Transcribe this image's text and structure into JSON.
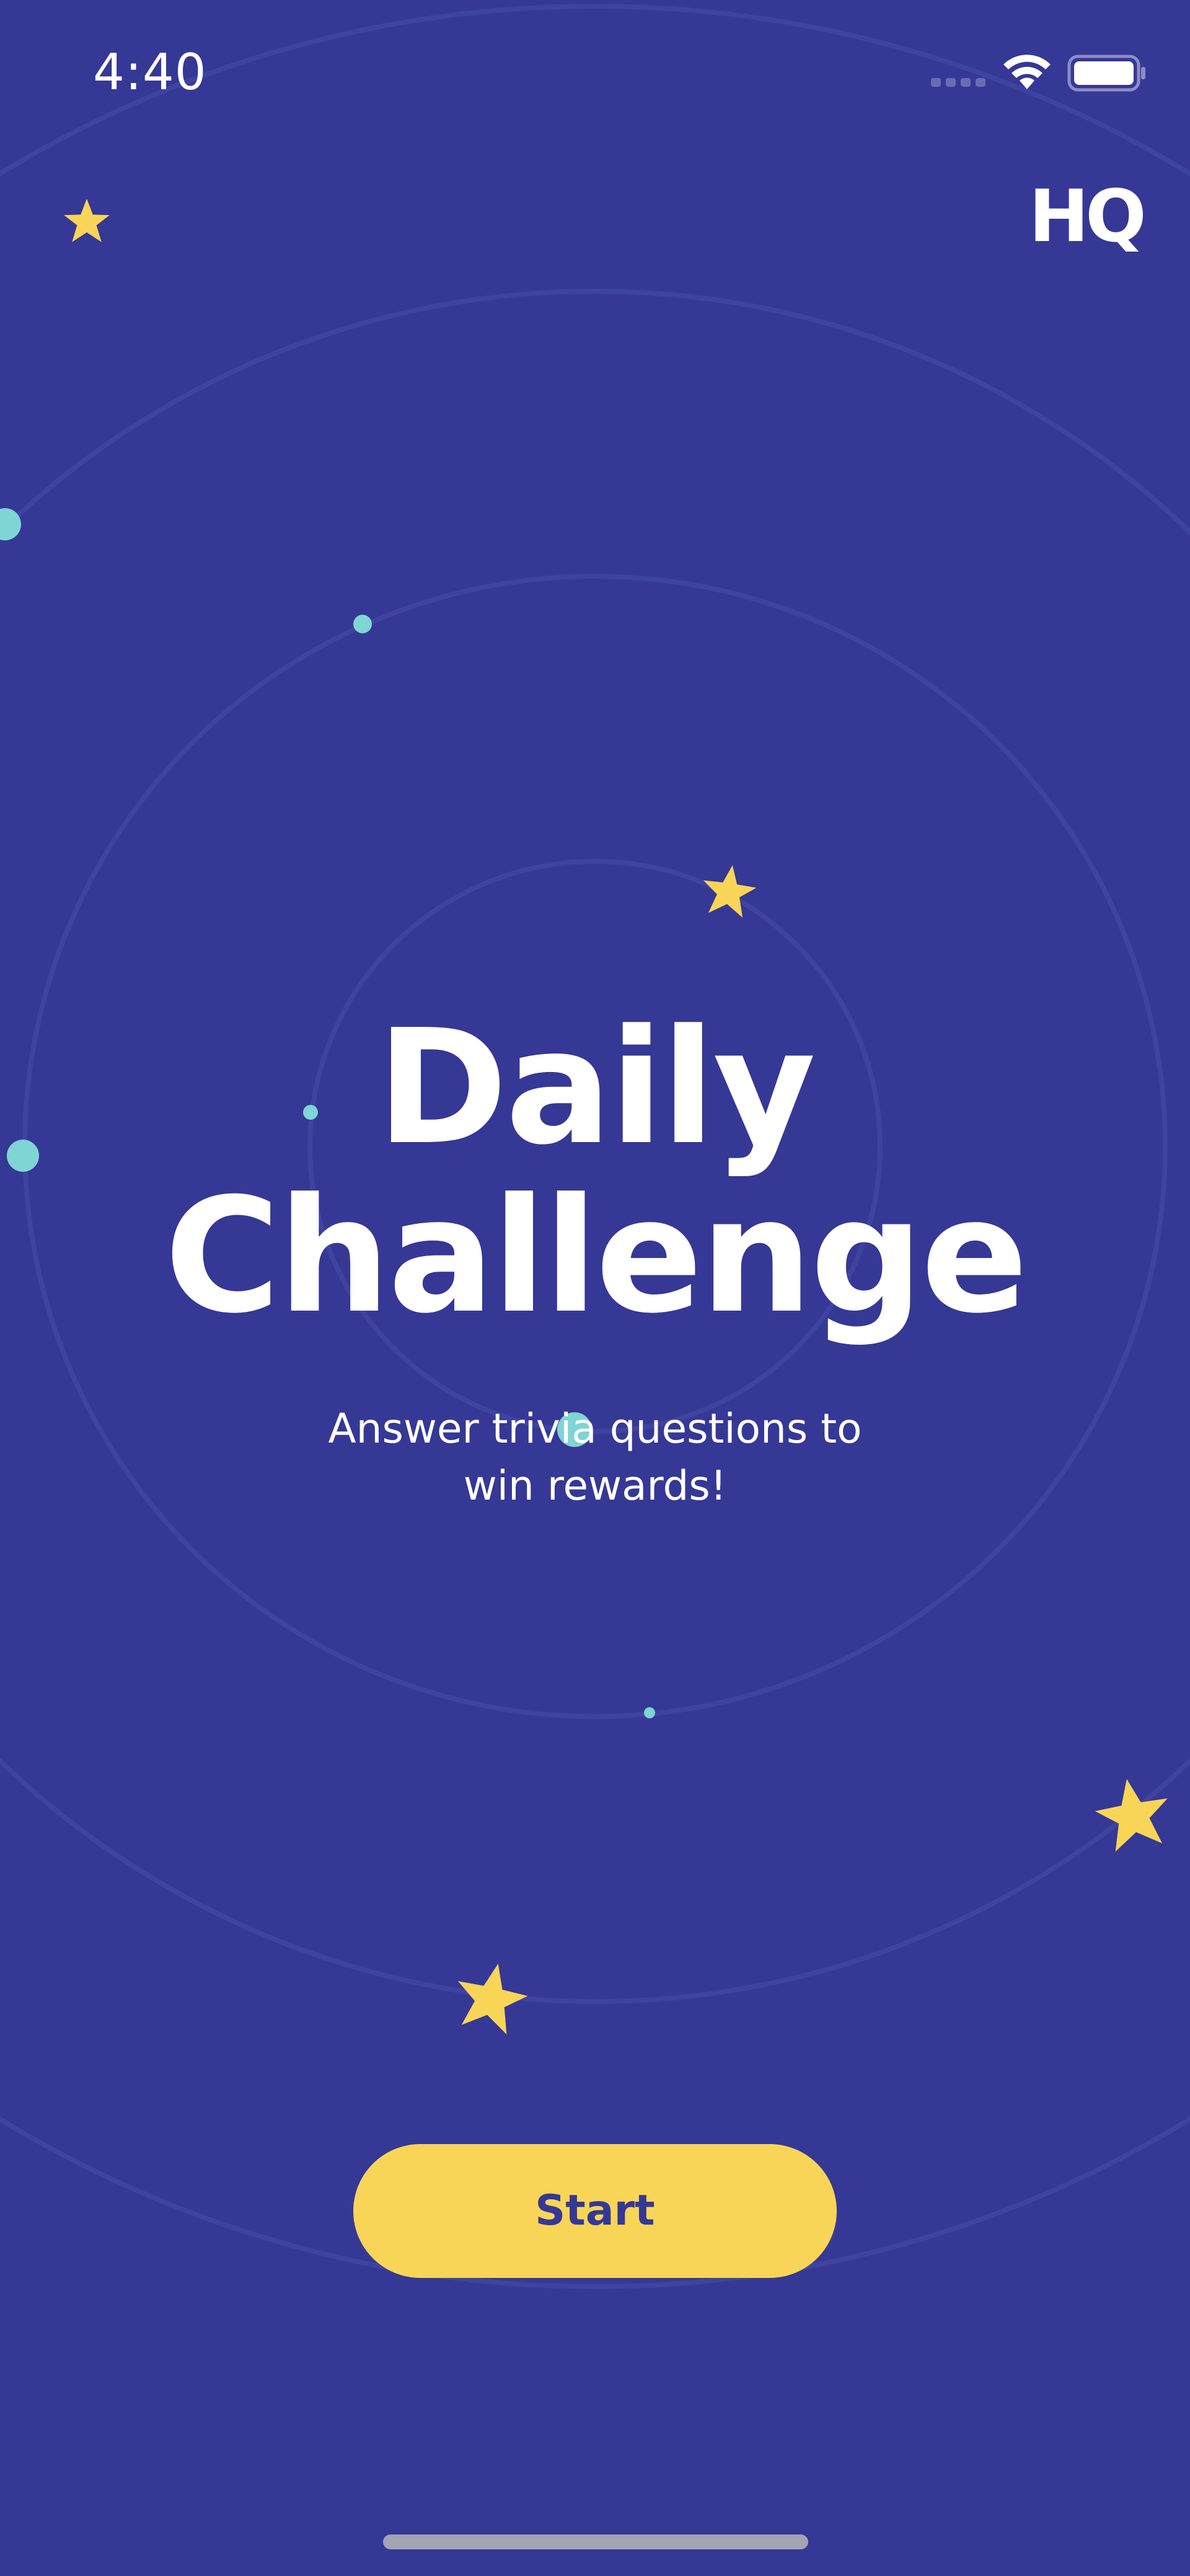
{
  "status_bar": {
    "time": "4:40",
    "signal_icon": "cellular-signal-icon",
    "wifi_icon": "wifi-icon",
    "battery_icon": "battery-icon"
  },
  "header": {
    "logo_text": "HQ",
    "star_icon": "star-icon"
  },
  "main": {
    "title_line1": "Daily",
    "title_line2": "Challenge",
    "subtitle_line1": "Answer trivia questions to",
    "subtitle_line2": "win rewards!"
  },
  "actions": {
    "start_label": "Start"
  },
  "decorations": {
    "star_icon": "star-icon",
    "dot_icon": "dot-icon"
  },
  "colors": {
    "background": "#353895",
    "accent_yellow": "#f8d557",
    "dot_teal": "#7fd4d4",
    "text_white": "#ffffff",
    "button_text": "#353895"
  }
}
